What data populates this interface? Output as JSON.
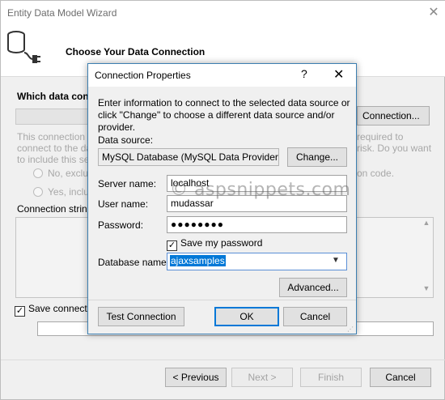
{
  "wizard": {
    "title": "Entity Data Model Wizard",
    "close_glyph": "✕",
    "subtitle": "Choose Your Data Connection",
    "which_label": "Which data conne",
    "new_connection_btn": "Connection...",
    "info_line1": "This connection st",
    "info_line2": "connect to the data",
    "info_line3": "to include this sen",
    "info_right1": "required to",
    "info_right2": "risk. Do you want",
    "radio_no": "No, exclud",
    "radio_yes": "Yes, inclu",
    "info_right3": "on code.",
    "conn_string_label": "Connection string:",
    "save_connection_label": "Save connectio",
    "buttons": {
      "previous": "< Previous",
      "next": "Next >",
      "finish": "Finish",
      "cancel": "Cancel"
    }
  },
  "dialog": {
    "title": "Connection Properties",
    "help_glyph": "?",
    "close_glyph": "✕",
    "instructions": "Enter information to connect to the selected data source or click \"Change\" to choose a different data source and/or provider.",
    "data_source_label": "Data source:",
    "data_source_value": "MySQL Database (MySQL Data Provider)",
    "change_btn": "Change...",
    "server_name_label": "Server name:",
    "server_name_value": "localhost",
    "user_name_label": "User name:",
    "user_name_value": "mudassar",
    "password_label": "Password:",
    "password_value": "●●●●●●●●",
    "save_password_label": "Save my password",
    "save_password_checked": true,
    "database_name_label": "Database name:",
    "database_name_value": "ajaxsamples",
    "advanced_btn": "Advanced...",
    "test_connection_btn": "Test Connection",
    "ok_btn": "OK",
    "cancel_btn": "Cancel"
  },
  "watermark": "© aspsnippets.com",
  "icons": [
    "database-plug-icon",
    "chevron-down-icon",
    "checkmark-icon",
    "resize-grip-icon"
  ],
  "colors": {
    "accent": "#0078d7",
    "dialog_border": "#3c7fb1"
  }
}
